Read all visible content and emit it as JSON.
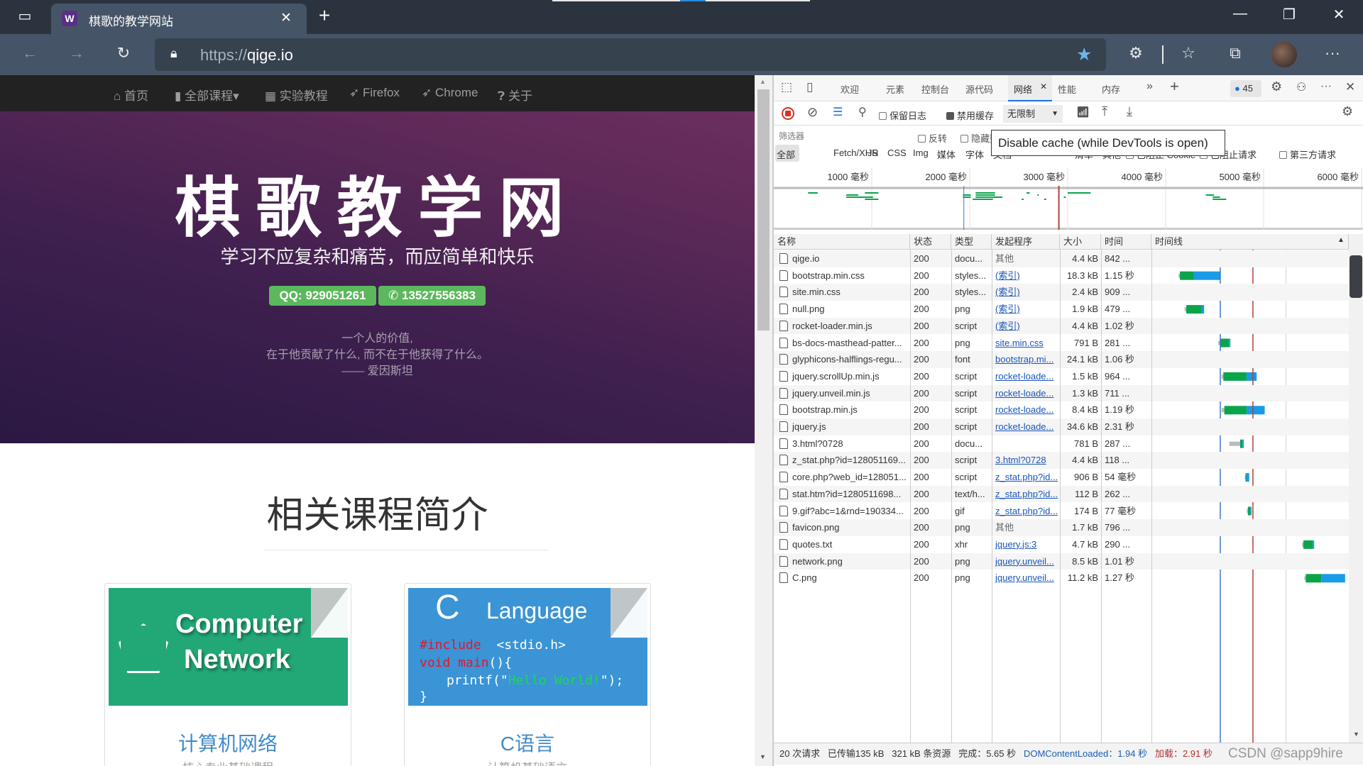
{
  "browser": {
    "tab_title": "棋歌的教学网站",
    "favicon_letter": "W",
    "url_scheme": "https://",
    "url_host": "qige.io",
    "colors": {
      "tabstrip": "#2b333e",
      "toolbar": "#465467",
      "favorite_star": "#6cb4ec"
    }
  },
  "page": {
    "nav": [
      "首页",
      "全部课程▾",
      "实验教程",
      "Firefox",
      "Chrome",
      "关于"
    ],
    "title": "棋歌教学网",
    "subtitle": "学习不应复杂和痛苦，而应简单和快乐",
    "qq_button": "QQ: 929051261",
    "phone_button": "13527556383",
    "quote": [
      "一个人的价值,",
      "在于他贡献了什么, 而不在于他获得了什么。",
      "—— 爱因斯坦"
    ],
    "section_title": "相关课程简介",
    "cards": [
      {
        "image_text": [
          "Computer",
          "Network"
        ],
        "title": "计算机网络",
        "subtitle": "核心专业基础课程",
        "image_color": "#22a876"
      },
      {
        "image_text": [
          "C",
          "Language",
          "#include",
          "<stdio.h>",
          "void main",
          "(){",
          "printf(\"",
          "Hello World!",
          "\");",
          "}"
        ],
        "title": "C语言",
        "subtitle": "计算机基础语言",
        "image_color": "#3a94d6"
      }
    ]
  },
  "devtools": {
    "tabs": [
      "欢迎",
      "元素",
      "控制台",
      "源代码",
      "网络",
      "性能",
      "内存"
    ],
    "active_tab": "网络",
    "issues_count": "45",
    "toolbar": {
      "preserve_log": "保留日志",
      "disable_cache": "禁用缓存",
      "throttle": "无限制"
    },
    "filter": {
      "placeholder": "筛选器",
      "invert": "反转",
      "hide_data_urls": "隐藏数据 URL"
    },
    "types": [
      "全部",
      "Fetch/XHR",
      "JS",
      "CSS",
      "Img",
      "媒体",
      "字体",
      "文档",
      "WS",
      "Wasm",
      "清单",
      "其他"
    ],
    "blocked_cookies": "已阻止 Cookie",
    "blocked_requests": "已阻止请求",
    "third_party": "第三方请求",
    "tooltip": "Disable cache (while DevTools is open)",
    "overview_ticks": [
      "1000 毫秒",
      "2000 毫秒",
      "3000 毫秒",
      "4000 毫秒",
      "5000 毫秒",
      "6000 毫秒"
    ],
    "columns": [
      "名称",
      "状态",
      "类型",
      "发起程序",
      "大小",
      "时间",
      "时间线"
    ],
    "rows": [
      {
        "name": "qige.io",
        "status": "200",
        "type": "docu...",
        "initiator": "其他",
        "link": false,
        "size": "4.4 kB",
        "time": "842 ...",
        "timeline": [
          0.03,
          0.35,
          0.68,
          1.01
        ]
      },
      {
        "name": "bootstrap.min.css",
        "status": "200",
        "type": "styles...",
        "initiator": "(索引)",
        "link": true,
        "size": "18.3 kB",
        "time": "1.15 秒",
        "timeline": [
          0.7,
          0.74,
          1.15,
          1.93
        ]
      },
      {
        "name": "site.min.css",
        "status": "200",
        "type": "styles...",
        "initiator": "(索引)",
        "link": true,
        "size": "2.4 kB",
        "time": "909 ...",
        "timeline": [
          0.7,
          0.74,
          1.65,
          1.69
        ]
      },
      {
        "name": "null.png",
        "status": "200",
        "type": "png",
        "initiator": "(索引)",
        "link": true,
        "size": "1.9 kB",
        "time": "479 ...",
        "timeline": [
          0.88,
          0.93,
          1.39,
          1.46
        ]
      },
      {
        "name": "rocket-loader.min.js",
        "status": "200",
        "type": "script",
        "initiator": "(索引)",
        "link": true,
        "size": "4.4 kB",
        "time": "1.02 秒",
        "timeline": [
          0.88,
          0.93,
          1.39,
          2.0
        ]
      },
      {
        "name": "bs-docs-masthead-patter...",
        "status": "200",
        "type": "png",
        "initiator": "site.min.css",
        "link": true,
        "size": "791 B",
        "time": "281 ...",
        "timeline": [
          1.88,
          1.93,
          2.2,
          2.24
        ]
      },
      {
        "name": "glyphicons-halflings-regu...",
        "status": "200",
        "type": "font",
        "initiator": "bootstrap.mi...",
        "link": true,
        "size": "24.1 kB",
        "time": "1.06 秒",
        "timeline": [
          1.88,
          1.93,
          2.2,
          3.02
        ]
      },
      {
        "name": "jquery.scrollUp.min.js",
        "status": "200",
        "type": "script",
        "initiator": "rocket-loade...",
        "link": true,
        "size": "1.5 kB",
        "time": "964 ...",
        "timeline": [
          1.98,
          2.03,
          2.72,
          3.02
        ]
      },
      {
        "name": "jquery.unveil.min.js",
        "status": "200",
        "type": "script",
        "initiator": "rocket-loade...",
        "link": true,
        "size": "1.3 kB",
        "time": "711 ...",
        "timeline": [
          1.98,
          2.06,
          2.72,
          2.76
        ]
      },
      {
        "name": "bootstrap.min.js",
        "status": "200",
        "type": "script",
        "initiator": "rocket-loade...",
        "link": true,
        "size": "8.4 kB",
        "time": "1.19 秒",
        "timeline": [
          1.98,
          2.06,
          2.72,
          3.26
        ]
      },
      {
        "name": "jquery.js",
        "status": "200",
        "type": "script",
        "initiator": "rocket-loade...",
        "link": true,
        "size": "34.6 kB",
        "time": "2.31 秒",
        "timeline": [
          1.98,
          2.06,
          2.97,
          4.37
        ]
      },
      {
        "name": "3.html?0728",
        "status": "200",
        "type": "docu...",
        "initiator": "",
        "link": false,
        "size": "781 B",
        "time": "287 ...",
        "timeline": [
          2.21,
          2.53,
          2.6,
          2.64
        ]
      },
      {
        "name": "z_stat.php?id=128051169...",
        "status": "200",
        "type": "script",
        "initiator": "3.html?0728",
        "link": true,
        "size": "4.4 kB",
        "time": "118 ...",
        "timeline": [
          2.55,
          2.58,
          2.69,
          2.73
        ]
      },
      {
        "name": "core.php?web_id=128051...",
        "status": "200",
        "type": "script",
        "initiator": "z_stat.php?id...",
        "link": true,
        "size": "906 B",
        "time": "54 毫秒",
        "timeline": [
          2.67,
          2.69,
          2.71,
          2.8
        ]
      },
      {
        "name": "stat.htm?id=1280511698...",
        "status": "200",
        "type": "text/h...",
        "initiator": "z_stat.php?id...",
        "link": true,
        "size": "112 B",
        "time": "262 ...",
        "timeline": [
          2.7,
          2.96,
          3.03,
          3.07
        ]
      },
      {
        "name": "9.gif?abc=1&rnd=190334...",
        "status": "200",
        "type": "gif",
        "initiator": "z_stat.php?id...",
        "link": true,
        "size": "174 B",
        "time": "77 毫秒",
        "timeline": [
          2.73,
          2.76,
          2.83,
          2.87
        ]
      },
      {
        "name": "favicon.png",
        "status": "200",
        "type": "png",
        "initiator": "其他",
        "link": false,
        "size": "1.7 kB",
        "time": "796 ...",
        "timeline": [
          2.96,
          3.0,
          3.78,
          3.83
        ]
      },
      {
        "name": "quotes.txt",
        "status": "200",
        "type": "xhr",
        "initiator": "jquery.js:3",
        "link": true,
        "size": "4.7 kB",
        "time": "290 ...",
        "timeline": [
          4.37,
          4.41,
          4.69,
          4.73
        ]
      },
      {
        "name": "network.png",
        "status": "200",
        "type": "png",
        "initiator": "jquery.unveil...",
        "link": true,
        "size": "8.5 kB",
        "time": "1.01 秒",
        "timeline": [
          4.44,
          4.48,
          4.73,
          5.52
        ]
      },
      {
        "name": "C.png",
        "status": "200",
        "type": "png",
        "initiator": "jquery.unveil...",
        "link": true,
        "size": "11.2 kB",
        "time": "1.27 秒",
        "timeline": [
          4.44,
          4.48,
          4.94,
          5.65
        ]
      }
    ],
    "dom_content_loaded_s": 1.94,
    "load_s": 2.91,
    "status": {
      "requests": "20 次请求",
      "transferred": "已传输135 kB",
      "resources": "321 kB 条资源",
      "finish": "完成：5.65 秒",
      "dcl": "DOMContentLoaded：1.94 秒",
      "load": "加载：2.91 秒"
    },
    "colors": {
      "waiting": "#0aa54a",
      "download": "#1a9be6",
      "dcl_line": "#3b78c9",
      "load_line": "#b0413e",
      "record": "#d93025"
    }
  },
  "watermark": "CSDN @sapp9hire"
}
